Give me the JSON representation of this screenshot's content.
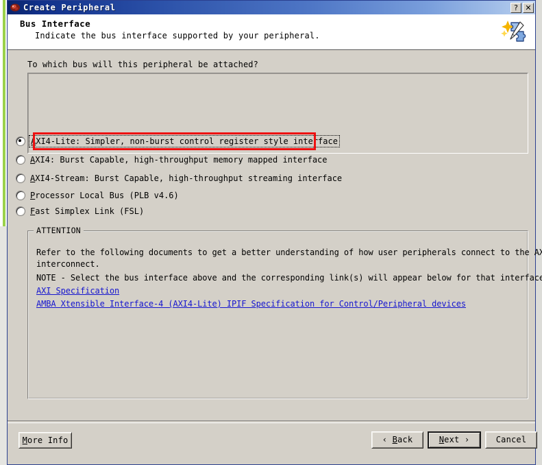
{
  "window": {
    "title": "Create Peripheral",
    "icon": "peripheral-wizard-icon",
    "help_button": "?",
    "close_button": "✕"
  },
  "header": {
    "title": "Bus Interface",
    "subtitle": "Indicate the bus interface supported by your peripheral.",
    "icon": "puzzle-piece-wand-icon"
  },
  "main": {
    "question": "To which bus will this peripheral be attached?",
    "bus_options": [
      {
        "id": "axi4-lite",
        "mnemonic": "A",
        "prefix": "",
        "rest": "XI4-Lite: Simpler, non-burst control register style interface",
        "selected": true,
        "focused": true,
        "highlighted": true
      },
      {
        "id": "axi4",
        "mnemonic": "A",
        "prefix": "",
        "rest": "XI4: Burst Capable, high-throughput memory mapped interface",
        "selected": false,
        "focused": false,
        "highlighted": false
      },
      {
        "id": "axi4-stream",
        "mnemonic": "A",
        "prefix": "",
        "rest": "XI4-Stream: Burst Capable, high-throughput streaming interface",
        "selected": false,
        "focused": false,
        "highlighted": false
      },
      {
        "id": "plb",
        "mnemonic": "P",
        "prefix": "",
        "rest": "rocessor Local Bus (PLB v4.6)",
        "selected": false,
        "focused": false,
        "highlighted": false
      },
      {
        "id": "fsl",
        "mnemonic": "F",
        "prefix": "",
        "rest": "ast Simplex Link (FSL)",
        "selected": false,
        "focused": false,
        "highlighted": false
      }
    ]
  },
  "attention": {
    "legend": "ATTENTION",
    "line1": "Refer to the following documents to get a better understanding of how user peripherals connect to the AXI bus",
    "line2": "interconnect.",
    "line3": "NOTE - Select the bus interface above and the corresponding link(s) will appear below for that interface.",
    "links": [
      "AXI Specification",
      "AMBA Xtensible Interface-4 (AXI4-Lite) IPIF Specification for Control/Peripheral devices"
    ]
  },
  "footer": {
    "more_info": {
      "mnemonic": "M",
      "rest": "ore Info"
    },
    "back": {
      "glyph": "‹ ",
      "mnemonic": "B",
      "rest": "ack"
    },
    "next": {
      "mnemonic": "N",
      "rest": "ext",
      "glyph": " ›",
      "is_default": true
    },
    "cancel": {
      "label": "Cancel"
    }
  },
  "colors": {
    "dialog_face": "#d4d0c8",
    "title_gradient_start": "#0a246a",
    "title_gradient_end": "#c3d6f0",
    "link": "#1515cf",
    "annotation_red": "#ee1111",
    "desktop_green": "#9ad14b"
  }
}
